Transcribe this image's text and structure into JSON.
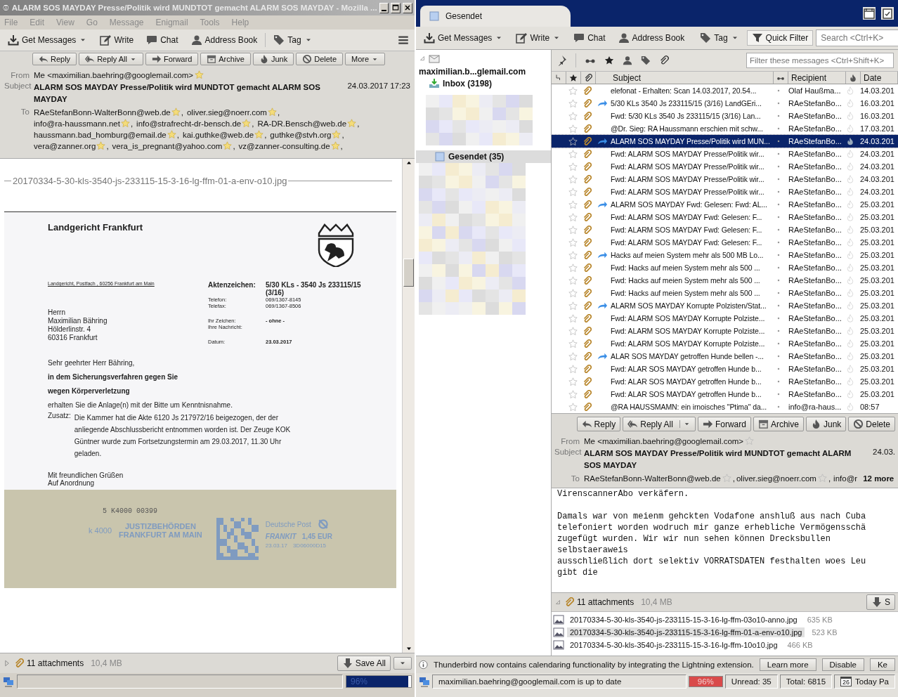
{
  "left_window": {
    "title": "ALARM SOS MAYDAY Presse/Politik wird MUNDTOT gemacht ALARM SOS MAYDAY - Mozilla ...",
    "menu": [
      "File",
      "Edit",
      "View",
      "Go",
      "Message",
      "Enigmail",
      "Tools",
      "Help"
    ],
    "toolbar": [
      {
        "label": "Get Messages",
        "dropdown": true
      },
      {
        "label": "Write",
        "dropdown": false
      },
      {
        "label": "Chat",
        "dropdown": false
      },
      {
        "label": "Address Book",
        "dropdown": false
      },
      {
        "label": "Tag",
        "dropdown": true
      }
    ],
    "header_buttons": [
      {
        "label": "Reply",
        "dropdown": false
      },
      {
        "label": "Reply All",
        "dropdown": true
      },
      {
        "label": "Forward",
        "dropdown": false
      },
      {
        "label": "Archive",
        "dropdown": false
      },
      {
        "label": "Junk",
        "dropdown": false
      },
      {
        "label": "Delete",
        "dropdown": false
      },
      {
        "label": "More",
        "dropdown": true
      }
    ],
    "header": {
      "from_label": "From",
      "from": "Me <maximilian.baehring@googlemail.com>",
      "subject_label": "Subject",
      "subject": "ALARM SOS MAYDAY Presse/Politik wird MUNDTOT gemacht ALARM SOS MAYDAY",
      "date": "24.03.2017 17:23",
      "to_label": "To",
      "to_lines": [
        [
          {
            "address": "RAeStefanBonn-WalterBonn@web.de",
            "trailing": ","
          },
          {
            "address": "oliver.sieg@noerr.com",
            "trailing": ","
          }
        ],
        [
          {
            "address": "info@ra-haussmann.net",
            "trailing": ","
          },
          {
            "address": "info@strafrecht-dr-bensch.de",
            "trailing": ","
          },
          {
            "address": "RA-DR.Bensch@web.de",
            "trailing": ","
          }
        ],
        [
          {
            "address": "haussmann.bad_homburg@email.de",
            "trailing": ","
          },
          {
            "address": "kai.guthke@web.de",
            "trailing": ","
          },
          {
            "address": "guthke@stvh.org",
            "trailing": ","
          }
        ],
        [
          {
            "address": "vera@zanner.org",
            "trailing": ","
          },
          {
            "address": "vera_is_pregnant@yahoo.com",
            "trailing": ","
          },
          {
            "address": "vz@zanner-consulting.de",
            "trailing": ","
          }
        ]
      ]
    },
    "attachment_separator": "20170334-5-30-kls-3540-js-233115-15-3-16-lg-ffm-01-a-env-o10.jpg",
    "letter": {
      "court": "Landgericht Frankfurt",
      "return_address": "Landgericht, Postfach , 60256 Frankfurt am Main",
      "references": [
        {
          "label": "Aktenzeichen:",
          "value": "5/30 KLs - 3540 Js 233115/15 (3/16)",
          "kind": "main"
        },
        {
          "label": "Telefon:",
          "value": "069/1367-8145",
          "kind": "small"
        },
        {
          "label": "Telefax:",
          "value": "069/1367-8506",
          "kind": "small"
        },
        {
          "label": "Ihr Zeichen:",
          "value": "- ohne -",
          "kind": "gap"
        },
        {
          "label": "Ihre Nachricht:",
          "kind": "small"
        },
        {
          "label": "Datum:",
          "value": "23.03.2017",
          "kind": "gap"
        }
      ],
      "recipient": [
        "Herrn",
        "Maximilian Bähring",
        "Hölderlinstr. 4",
        "60316 Frankfurt"
      ],
      "salutation": "Sehr geehrter Herr Bähring,",
      "bold_lines": [
        "in dem Sicherungsverfahren gegen Sie",
        "wegen Körperverletzung"
      ],
      "paragraph": "erhalten Sie die Anlage(n) mit der Bitte um Kenntnisnahme.",
      "note_label": "Zusatz:",
      "note": "Die Kammer hat die Akte 6120 Js 217972/16 beigezogen, der der anliegende Abschlussbericht entnommen worden ist. Der Zeuge KOK Güntner wurde zum Fortsetzungstermin am 29.03.2017, 11.30 Uhr geladen.",
      "closing": [
        "Mit freundlichen Grüßen",
        "Auf Anordnung"
      ]
    },
    "envelope": {
      "code": "5 K4000 00399",
      "sender_code": "k 4000",
      "sender": [
        "JUSTIZBEHÖRDEN",
        "FRANKFURT AM MAIN"
      ],
      "postage": {
        "carrier": "Deutsche Post",
        "product": "FRANKIT",
        "price": "1,45 EUR",
        "date": "23.03.17",
        "number": "3D06000D15"
      }
    },
    "attachments": {
      "count": "11 attachments",
      "size": "10,4 MB",
      "save_button": "Save All"
    },
    "status": {
      "progress_text": "96%",
      "level": 0.96
    }
  },
  "right_window": {
    "tab": {
      "label": "Gesendet",
      "selected": true
    },
    "toolbar": [
      {
        "label": "Get Messages",
        "dropdown": true
      },
      {
        "label": "Write",
        "dropdown": true
      },
      {
        "label": "Chat",
        "dropdown": false
      },
      {
        "label": "Address Book",
        "dropdown": false
      },
      {
        "label": "Tag",
        "dropdown": true
      },
      {
        "label": "Quick Filter",
        "dropdown": false
      }
    ],
    "search": {
      "placeholder": "Search <Ctrl+K>"
    },
    "folders": [
      {
        "label": "maximilian.b...glemail.com",
        "kind": "account",
        "selected": false
      },
      {
        "label": "Inbox (3198)",
        "kind": "inbox",
        "selected": false
      },
      {
        "label": "Gesendet (35)",
        "kind": "sent",
        "selected": true
      }
    ],
    "filter": {
      "placeholder": "Filter these messages <Ctrl+Shift+K>"
    },
    "columns": [
      "Subject",
      "Recipient",
      "Date"
    ],
    "messages": [
      {
        "subject": "elefonat - Erhalten: Scan 14.03.2017, 20.54...",
        "recipient": "Olaf Haußma...",
        "date": "14.03.201",
        "starred": false,
        "attachment": true,
        "forwarded": false,
        "selected": false
      },
      {
        "subject": "5/30 KLs 3540 Js 233115/15 (3/16) LandGEri...",
        "recipient": "RAeStefanBo...",
        "date": "16.03.201",
        "starred": false,
        "attachment": true,
        "forwarded": true,
        "selected": false
      },
      {
        "subject": "Fwd: 5/30 KLs 3540 Js 233115/15 (3/16) Lan...",
        "recipient": "RAeStefanBo...",
        "date": "16.03.201",
        "starred": false,
        "attachment": true,
        "forwarded": false,
        "selected": false
      },
      {
        "subject": "@Dr. Sieg: RA Haussmann erschien mit schw...",
        "recipient": "RAeStefanBo...",
        "date": "17.03.201",
        "starred": false,
        "attachment": true,
        "forwarded": false,
        "selected": false
      },
      {
        "subject": "ALARM SOS MAYDAY Presse/Politik wird MUN...",
        "recipient": "RAeStefanBo...",
        "date": "24.03.201",
        "starred": false,
        "attachment": true,
        "forwarded": true,
        "selected": true
      },
      {
        "subject": "Fwd: ALARM SOS MAYDAY Presse/Politik wir...",
        "recipient": "RAeStefanBo...",
        "date": "24.03.201",
        "starred": false,
        "attachment": true,
        "forwarded": false,
        "selected": false
      },
      {
        "subject": "Fwd: ALARM SOS MAYDAY Presse/Politik wir...",
        "recipient": "RAeStefanBo...",
        "date": "24.03.201",
        "starred": false,
        "attachment": true,
        "forwarded": false,
        "selected": false
      },
      {
        "subject": "Fwd: ALARM SOS MAYDAY Presse/Politik wir...",
        "recipient": "RAeStefanBo...",
        "date": "24.03.201",
        "starred": false,
        "attachment": true,
        "forwarded": false,
        "selected": false
      },
      {
        "subject": "Fwd: ALARM SOS MAYDAY Presse/Politik wir...",
        "recipient": "RAeStefanBo...",
        "date": "24.03.201",
        "starred": false,
        "attachment": true,
        "forwarded": false,
        "selected": false
      },
      {
        "subject": "ALARM SOS MAYDAY Fwd: Gelesen: Fwd: AL...",
        "recipient": "RAeStefanBo...",
        "date": "25.03.201",
        "starred": false,
        "attachment": true,
        "forwarded": true,
        "selected": false
      },
      {
        "subject": "Fwd: ALARM SOS MAYDAY Fwd: Gelesen: F...",
        "recipient": "RAeStefanBo...",
        "date": "25.03.201",
        "starred": false,
        "attachment": true,
        "forwarded": false,
        "selected": false
      },
      {
        "subject": "Fwd: ALARM SOS MAYDAY Fwd: Gelesen: F...",
        "recipient": "RAeStefanBo...",
        "date": "25.03.201",
        "starred": false,
        "attachment": true,
        "forwarded": false,
        "selected": false
      },
      {
        "subject": "Fwd: ALARM SOS MAYDAY Fwd: Gelesen: F...",
        "recipient": "RAeStefanBo...",
        "date": "25.03.201",
        "starred": false,
        "attachment": true,
        "forwarded": false,
        "selected": false
      },
      {
        "subject": "Hacks auf meien System mehr als 500 MB Lo...",
        "recipient": "RAeStefanBo...",
        "date": "25.03.201",
        "starred": false,
        "attachment": true,
        "forwarded": true,
        "selected": false
      },
      {
        "subject": "Fwd: Hacks auf meien System mehr als 500 ...",
        "recipient": "RAeStefanBo...",
        "date": "25.03.201",
        "starred": false,
        "attachment": true,
        "forwarded": false,
        "selected": false
      },
      {
        "subject": "Fwd: Hacks auf meien System mehr als 500 ...",
        "recipient": "RAeStefanBo...",
        "date": "25.03.201",
        "starred": false,
        "attachment": true,
        "forwarded": false,
        "selected": false
      },
      {
        "subject": "Fwd: Hacks auf meien System mehr als 500 ...",
        "recipient": "RAeStefanBo...",
        "date": "25.03.201",
        "starred": false,
        "attachment": true,
        "forwarded": false,
        "selected": false
      },
      {
        "subject": "ALARM SOS MAYDAY Korrupte Polzisten/Stat...",
        "recipient": "RAeStefanBo...",
        "date": "25.03.201",
        "starred": false,
        "attachment": true,
        "forwarded": true,
        "selected": false
      },
      {
        "subject": "Fwd: ALARM SOS MAYDAY Korrupte Polziste...",
        "recipient": "RAeStefanBo...",
        "date": "25.03.201",
        "starred": false,
        "attachment": true,
        "forwarded": false,
        "selected": false
      },
      {
        "subject": "Fwd: ALARM SOS MAYDAY Korrupte Polziste...",
        "recipient": "RAeStefanBo...",
        "date": "25.03.201",
        "starred": false,
        "attachment": true,
        "forwarded": false,
        "selected": false
      },
      {
        "subject": "Fwd: ALARM SOS MAYDAY Korrupte Polziste...",
        "recipient": "RAeStefanBo...",
        "date": "25.03.201",
        "starred": false,
        "attachment": true,
        "forwarded": false,
        "selected": false
      },
      {
        "subject": "ALAR SOS MAYDAY getroffen Hunde bellen -...",
        "recipient": "RAeStefanBo...",
        "date": "25.03.201",
        "starred": false,
        "attachment": true,
        "forwarded": true,
        "selected": false
      },
      {
        "subject": "Fwd: ALAR SOS MAYDAY getroffen Hunde b...",
        "recipient": "RAeStefanBo...",
        "date": "25.03.201",
        "starred": false,
        "attachment": true,
        "forwarded": false,
        "selected": false
      },
      {
        "subject": "Fwd: ALAR SOS MAYDAY getroffen Hunde b...",
        "recipient": "RAeStefanBo...",
        "date": "25.03.201",
        "starred": false,
        "attachment": true,
        "forwarded": false,
        "selected": false
      },
      {
        "subject": "Fwd: ALAR SOS MAYDAY getroffen Hunde b...",
        "recipient": "RAeStefanBo...",
        "date": "25.03.201",
        "starred": false,
        "attachment": true,
        "forwarded": false,
        "selected": false
      },
      {
        "subject": "@RA HAUSSMAMN: ein irnoisches \"Ptima\" da...",
        "recipient": "info@ra-haus...",
        "date": "08:57",
        "starred": false,
        "attachment": true,
        "forwarded": false,
        "selected": false
      }
    ],
    "header_buttons": [
      {
        "label": "Reply",
        "dropdown": false
      },
      {
        "label": "Reply All",
        "dropdown": true
      },
      {
        "label": "Forward",
        "dropdown": false
      },
      {
        "label": "Archive",
        "dropdown": false
      },
      {
        "label": "Junk",
        "dropdown": false
      },
      {
        "label": "Delete",
        "dropdown": false
      }
    ],
    "header": {
      "from_label": "From",
      "from": "Me <maximilian.baehring@googlemail.com>",
      "subject_label": "Subject",
      "subject": "ALARM SOS MAYDAY Presse/Politik wird MUNDTOT gemacht ALARM SOS MAYDAY",
      "date": "24.03.",
      "to_label": "To",
      "to": [
        {
          "address": "RAeStefanBonn-WalterBonn@web.de",
          "trailing": ","
        },
        {
          "address": "oliver.sieg@noerr.com",
          "trailing": ","
        }
      ],
      "to_cut": "info@r",
      "more": "12 more"
    },
    "body": [
      [
        "VirenscannerAbo verkäfern."
      ],
      [
        "Damals war von meienm gehckten Vodafone anshluß aus nach Cuba",
        "telefoniert worden wodruch mir ganze erhebliche Vermögensschä",
        "zugefügt wurden. Wir wir nun sehen können Drecksbullen",
        "selbstaeraweis",
        "ausschließlich dort selektiv VORRATSDATEN festhalten woes Leu",
        "gibt die"
      ]
    ],
    "attachments": {
      "count": "11 attachments",
      "size": "10,4 MB",
      "save_button": "S",
      "files": [
        {
          "name": "20170334-5-30-kls-3540-js-233115-15-3-16-lg-ffm-03o10-anno.jpg",
          "size": "635 KB",
          "selected": false
        },
        {
          "name": "20170334-5-30-kls-3540-js-233115-15-3-16-lg-ffm-01-a-env-o10.jpg",
          "size": "523 KB",
          "selected": true
        },
        {
          "name": "20170334-5-30-kls-3540-js-233115-15-3-16-lg-ffm-10o10.jpg",
          "size": "466 KB",
          "selected": false
        }
      ]
    },
    "notification": {
      "text": "Thunderbird now contains calendaring functionality by integrating the Lightning extension.",
      "buttons": [
        "Learn more",
        "Disable",
        "Ke"
      ]
    },
    "status": {
      "text": "maximilian.baehring@googlemail.com is up to date",
      "meter": "96%",
      "unread": "Unread: 35",
      "total": "Total: 6815",
      "calendar_day": "26",
      "today": "Today Pa"
    }
  }
}
